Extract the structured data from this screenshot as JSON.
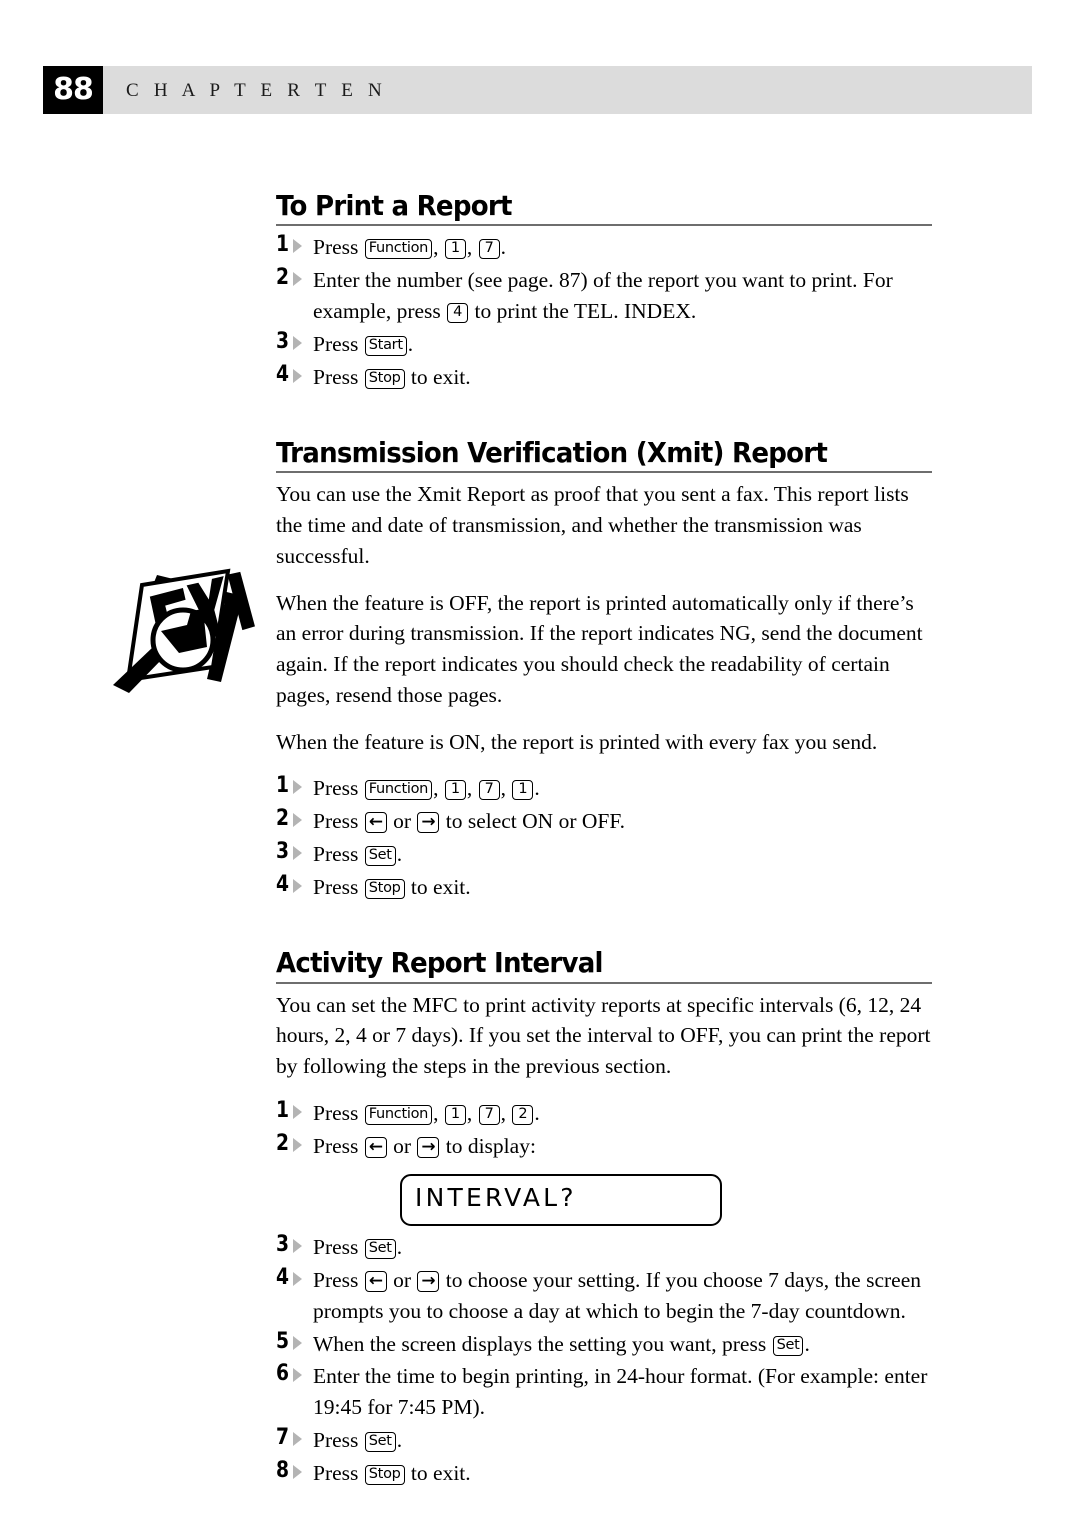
{
  "header": {
    "page_number": "88",
    "chapter_label": "C H A P T E R   T E N"
  },
  "margin_icon": {
    "name": "fyi-icon",
    "text": "FYI"
  },
  "sections": [
    {
      "id": "to-print-a-report",
      "heading": "To Print a Report",
      "steps": [
        {
          "number": "1",
          "parts": [
            {
              "t": "text",
              "v": "Press "
            },
            {
              "t": "key",
              "v": "Function"
            },
            {
              "t": "text",
              "v": ", "
            },
            {
              "t": "keynum",
              "v": "1"
            },
            {
              "t": "text",
              "v": ", "
            },
            {
              "t": "keynum",
              "v": "7"
            },
            {
              "t": "text",
              "v": "."
            }
          ]
        },
        {
          "number": "2",
          "parts": [
            {
              "t": "text",
              "v": "Enter the number (see page. 87) of the report you want to print.  For example, press "
            },
            {
              "t": "keynum",
              "v": "4"
            },
            {
              "t": "text",
              "v": " to print the TEL. INDEX."
            }
          ]
        },
        {
          "number": "3",
          "parts": [
            {
              "t": "text",
              "v": "Press "
            },
            {
              "t": "key",
              "v": "Start"
            },
            {
              "t": "text",
              "v": "."
            }
          ]
        },
        {
          "number": "4",
          "parts": [
            {
              "t": "text",
              "v": "Press "
            },
            {
              "t": "key",
              "v": "Stop"
            },
            {
              "t": "text",
              "v": " to exit."
            }
          ]
        }
      ]
    },
    {
      "id": "transmission-verification-xmit-report",
      "heading": "Transmission Verification (Xmit) Report",
      "paragraphs": [
        "You can use the Xmit Report as proof that you sent a fax.  This report lists the time and date of transmission, and whether the transmission was successful.",
        "When the feature is OFF, the report is printed automatically only if there’s an error during transmission.  If the report indicates NG, send the document again.  If the report indicates you should check the readability of certain pages, resend those pages.",
        "When the feature is ON, the report is printed with every fax you send."
      ],
      "steps": [
        {
          "number": "1",
          "parts": [
            {
              "t": "text",
              "v": "Press "
            },
            {
              "t": "key",
              "v": "Function"
            },
            {
              "t": "text",
              "v": ", "
            },
            {
              "t": "keynum",
              "v": "1"
            },
            {
              "t": "text",
              "v": ", "
            },
            {
              "t": "keynum",
              "v": "7"
            },
            {
              "t": "text",
              "v": ", "
            },
            {
              "t": "keynum",
              "v": "1"
            },
            {
              "t": "text",
              "v": "."
            }
          ]
        },
        {
          "number": "2",
          "parts": [
            {
              "t": "text",
              "v": "Press "
            },
            {
              "t": "keyarrow",
              "v": "←"
            },
            {
              "t": "text",
              "v": " or "
            },
            {
              "t": "keyarrow",
              "v": "→"
            },
            {
              "t": "text",
              "v": " to select ON or OFF."
            }
          ]
        },
        {
          "number": "3",
          "parts": [
            {
              "t": "text",
              "v": "Press "
            },
            {
              "t": "key",
              "v": "Set"
            },
            {
              "t": "text",
              "v": "."
            }
          ]
        },
        {
          "number": "4",
          "parts": [
            {
              "t": "text",
              "v": "Press "
            },
            {
              "t": "key",
              "v": "Stop"
            },
            {
              "t": "text",
              "v": " to exit."
            }
          ]
        }
      ]
    },
    {
      "id": "activity-report-interval",
      "heading": "Activity Report Interval",
      "paragraphs": [
        "You can set the MFC to print activity reports at specific intervals (6, 12, 24 hours, 2, 4 or 7 days).  If you set the interval to OFF, you can print the report by following the steps in the previous section."
      ],
      "steps": [
        {
          "number": "1",
          "parts": [
            {
              "t": "text",
              "v": "Press "
            },
            {
              "t": "key",
              "v": "Function"
            },
            {
              "t": "text",
              "v": ", "
            },
            {
              "t": "keynum",
              "v": "1"
            },
            {
              "t": "text",
              "v": ", "
            },
            {
              "t": "keynum",
              "v": "7"
            },
            {
              "t": "text",
              "v": ", "
            },
            {
              "t": "keynum",
              "v": "2"
            },
            {
              "t": "text",
              "v": "."
            }
          ]
        },
        {
          "number": "2",
          "parts": [
            {
              "t": "text",
              "v": "Press "
            },
            {
              "t": "keyarrow",
              "v": "←"
            },
            {
              "t": "text",
              "v": " or "
            },
            {
              "t": "keyarrow",
              "v": "→"
            },
            {
              "t": "text",
              "v": " to display:"
            }
          ],
          "lcd": "INTERVAL?"
        },
        {
          "number": "3",
          "parts": [
            {
              "t": "text",
              "v": "Press "
            },
            {
              "t": "key",
              "v": "Set"
            },
            {
              "t": "text",
              "v": "."
            }
          ]
        },
        {
          "number": "4",
          "parts": [
            {
              "t": "text",
              "v": "Press "
            },
            {
              "t": "keyarrow",
              "v": "←"
            },
            {
              "t": "text",
              "v": " or "
            },
            {
              "t": "keyarrow",
              "v": "→"
            },
            {
              "t": "text",
              "v": " to choose your setting.  If you choose 7 days, the screen prompts you to choose a day at which to begin the 7-day countdown."
            }
          ]
        },
        {
          "number": "5",
          "parts": [
            {
              "t": "text",
              "v": "When the screen displays the setting you want, press "
            },
            {
              "t": "key",
              "v": "Set"
            },
            {
              "t": "text",
              "v": "."
            }
          ]
        },
        {
          "number": "6",
          "parts": [
            {
              "t": "text",
              "v": "Enter the time to begin printing, in 24-hour format.  (For example: enter 19:45 for 7:45 PM)."
            }
          ]
        },
        {
          "number": "7",
          "parts": [
            {
              "t": "text",
              "v": "Press "
            },
            {
              "t": "key",
              "v": "Set"
            },
            {
              "t": "text",
              "v": "."
            }
          ]
        },
        {
          "number": "8",
          "parts": [
            {
              "t": "text",
              "v": "Press "
            },
            {
              "t": "key",
              "v": "Stop"
            },
            {
              "t": "text",
              "v": " to exit."
            }
          ]
        }
      ]
    }
  ]
}
